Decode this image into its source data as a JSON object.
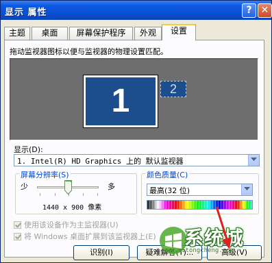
{
  "window": {
    "title": "显示 属性"
  },
  "titlebar": {
    "help_glyph": "?",
    "close_glyph": "✕"
  },
  "tabs": [
    {
      "label": "主题"
    },
    {
      "label": "桌面"
    },
    {
      "label": "屏幕保护程序"
    },
    {
      "label": "外观"
    },
    {
      "label": "设置",
      "active": true
    }
  ],
  "settings": {
    "instruction": "拖动监视器图标以便与监视器的物理设置匹配。",
    "monitors": [
      {
        "number": "1",
        "selected": true
      },
      {
        "number": "2",
        "selected": false
      }
    ],
    "display_label": "显示(D):",
    "display_value": "1. Intel(R) HD Graphics 上的 默认监视器",
    "resolution": {
      "group_title": "屏幕分辨率(S)",
      "low_label": "少",
      "high_label": "多",
      "value_text": "1440 x 900 像素",
      "slider_position": 0.5
    },
    "color": {
      "group_title": "颜色质量(C)",
      "selected": "最高(32 位)"
    },
    "checkboxes": [
      {
        "label": "使用该设备作为主监视器(U)",
        "checked": true,
        "enabled": false
      },
      {
        "label": "将 Windows 桌面扩展到该监视器上(E)",
        "checked": true,
        "enabled": false
      }
    ]
  },
  "buttons": {
    "identify": "识别(I)",
    "troubleshoot": "疑难解答(T)...",
    "advanced": "高级(V)"
  },
  "watermark": {
    "text": "系统城",
    "url": "www.xitongcheng.com"
  },
  "colors": {
    "title_blue": "#0b5be3",
    "group_title": "#0046d5",
    "monitor_blue": "#1c4d8c",
    "desk_gray": "#6e6e6e"
  }
}
